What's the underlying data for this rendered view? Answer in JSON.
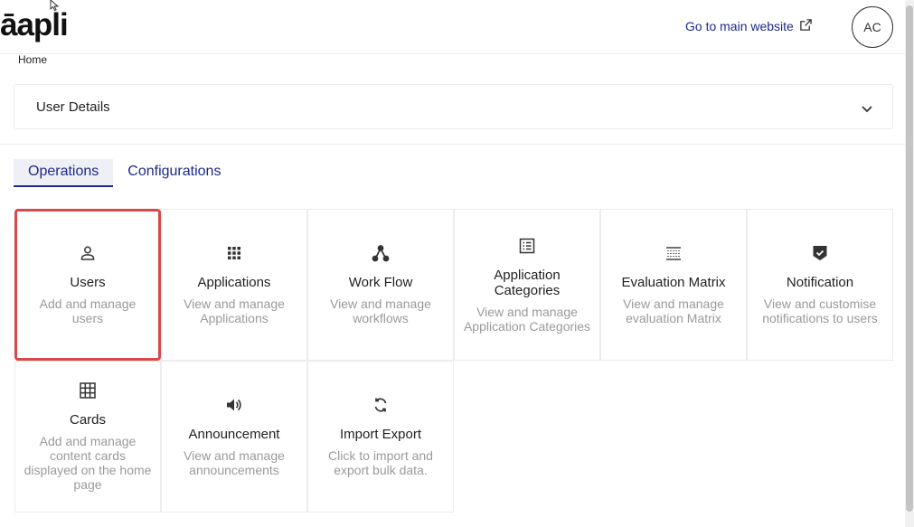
{
  "header": {
    "logo": "āapli",
    "main_link": "Go to main website",
    "avatar_initials": "AC"
  },
  "breadcrumb": "Home",
  "details": {
    "title": "User Details"
  },
  "tabs": [
    {
      "label": "Operations",
      "active": true
    },
    {
      "label": "Configurations",
      "active": false
    }
  ],
  "cards": [
    {
      "icon": "user-icon",
      "title": "Users",
      "desc": "Add and manage users",
      "selected": true
    },
    {
      "icon": "apps-grid-icon",
      "title": "Applications",
      "desc": "View and manage Applications"
    },
    {
      "icon": "workflow-icon",
      "title": "Work Flow",
      "desc": "View and manage workflows"
    },
    {
      "icon": "list-icon",
      "title": "Application Categories",
      "desc": "View and manage Application Categories"
    },
    {
      "icon": "matrix-icon",
      "title": "Evaluation Matrix",
      "desc": "View and manage evaluation Matrix"
    },
    {
      "icon": "verified-shield-icon",
      "title": "Notification",
      "desc": "View and customise notifications to users"
    },
    {
      "icon": "table-grid-icon",
      "title": "Cards",
      "desc": "Add and manage content cards displayed on the home page"
    },
    {
      "icon": "speaker-icon",
      "title": "Announcement",
      "desc": "View and manage announcements"
    },
    {
      "icon": "sync-icon",
      "title": "Import Export",
      "desc": "Click to import and export bulk data."
    }
  ],
  "colors": {
    "accent": "#1d2a8a",
    "selected_border": "#d8474a",
    "muted_text": "#9a9a9a"
  }
}
